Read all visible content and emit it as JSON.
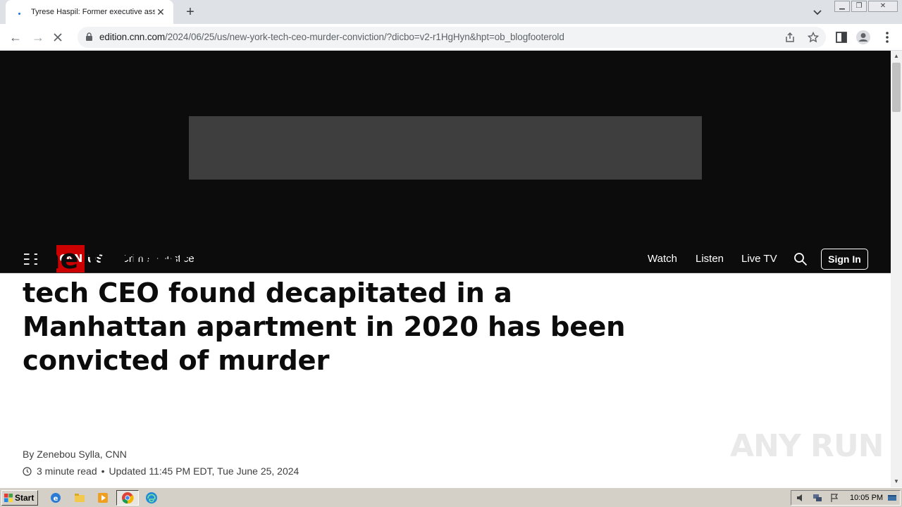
{
  "browser": {
    "tab_title": "Tyrese Haspil: Former executive assistant",
    "url_host": "edition.cnn.com",
    "url_path": "/2024/06/25/us/new-york-tech-ceo-murder-conviction/?dicbo=v2-r1HgHyn&hpt=ob_blogfooterold"
  },
  "site_nav": {
    "logo": "CNN",
    "section": "US",
    "subsection": "Crime + Justice",
    "links": [
      "Watch",
      "Listen",
      "Live TV"
    ],
    "sign_in": "Sign In"
  },
  "article": {
    "headline": "The former executive assistant to a tech CEO found decapitated in a Manhattan apartment in 2020 has been convicted of murder",
    "byline": "By Zenebou Sylla, CNN",
    "read_time": "3 minute read",
    "updated": "Updated 11:45 PM EDT, Tue June 25, 2024"
  },
  "watermark": "ANY RUN",
  "taskbar": {
    "start_label": "Start",
    "clock": "10:05 PM"
  }
}
